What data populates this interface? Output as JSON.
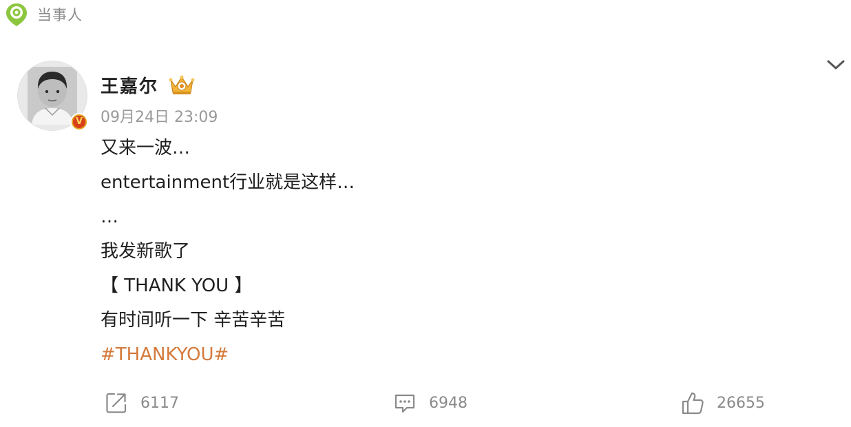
{
  "source_tag": {
    "icon": "location-pin-icon",
    "label": "当事人"
  },
  "post": {
    "author": {
      "name": "王嘉尔",
      "verified_badge": "V",
      "member_icon": "crown-icon"
    },
    "timestamp": "09月24日 23:09",
    "lines": [
      "又来一波…",
      "entertainment行业就是这样…",
      "…",
      "我发新歌了",
      "【 THANK YOU 】",
      "有时间听一下 辛苦辛苦"
    ],
    "hashtag": "#THANKYOU#",
    "more_icon": "chevron-down-icon"
  },
  "actions": {
    "repost": {
      "icon": "repost-icon",
      "count": "6117"
    },
    "comment": {
      "icon": "comment-icon",
      "count": "6948"
    },
    "like": {
      "icon": "thumbs-up-icon",
      "count": "26655"
    }
  },
  "colors": {
    "hashtag": "#d47a3c",
    "tag_icon": "#8cc63f",
    "muted_text": "#8a8a8a",
    "verified_badge": "#d8401c"
  }
}
